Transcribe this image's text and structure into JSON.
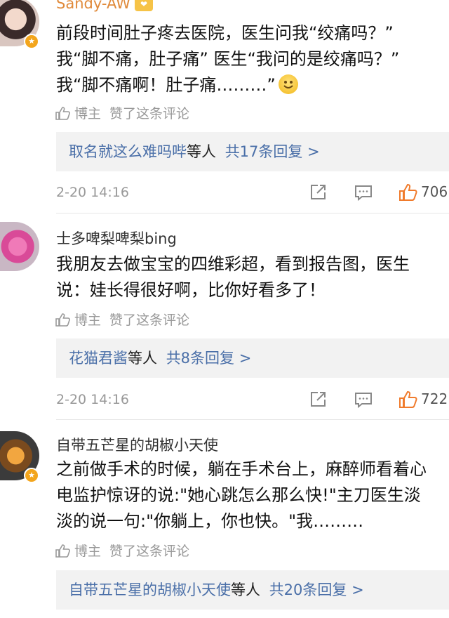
{
  "comments": [
    {
      "username": "Sandy-AW",
      "text_lines": [
        "前段时间肚子疼去医院，医生问我“绞痛吗？”",
        "我“脚不痛，肚子痛” 医生“我问的是绞痛吗？”",
        "我“脚不痛啊！肚子痛………”"
      ],
      "bozhu": "博主",
      "liked_text": "赞了这条评论",
      "reply_names": "取名就这么难吗哔",
      "reply_suffix": "等人",
      "reply_count": "共17条回复 >",
      "date": "2-20 14:16",
      "likes": "706"
    },
    {
      "username": "士多啤梨啤梨bing",
      "text_lines": [
        "我朋友去做宝宝的四维彩超，看到报告图，医生",
        "说：娃长得很好啊，比你好看多了！"
      ],
      "bozhu": "博主",
      "liked_text": "赞了这条评论",
      "reply_names": "花猫君酱",
      "reply_suffix": "等人",
      "reply_count": "共8条回复 >",
      "date": "2-20 14:16",
      "likes": "722"
    },
    {
      "username": "自带五芒星的胡椒小天使",
      "text_lines": [
        "之前做手术的时候，躺在手术台上，麻醉师看着心",
        "电监护惊讶的说:\"她心跳怎么那么快!\"主刀医生淡",
        "淡的说一句:\"你躺上，你也快。\"我………"
      ],
      "bozhu": "博主",
      "liked_text": "赞了这条评论",
      "reply_names": "自带五芒星的胡椒小天使",
      "reply_suffix": "等人",
      "reply_count": "共20条回复 >"
    }
  ],
  "colors": {
    "link": "#4a6fa8",
    "meta": "#999999",
    "like_icon": "#f07b2c",
    "reply_bg": "#f2f2f2",
    "username_vip": "#e08a3a"
  },
  "icons": [
    "thumb-up-icon",
    "share-icon",
    "comment-icon",
    "like-icon",
    "verified-badge-icon",
    "emoji-smile-icon"
  ]
}
